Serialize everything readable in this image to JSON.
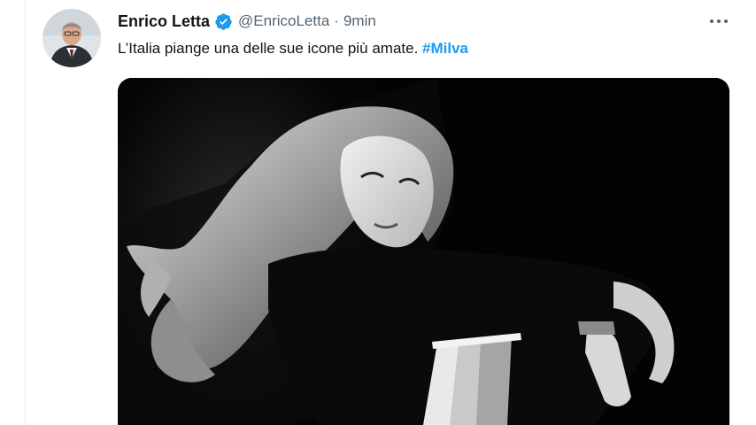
{
  "tweet": {
    "author": {
      "display_name": "Enrico Letta",
      "handle": "@EnricoLetta",
      "verified": true,
      "avatar_icon": "profile-photo"
    },
    "separator": "·",
    "timestamp": "9min",
    "text": "L’Italia piange una delle sue icone più amate. ",
    "hashtag": "#Milva",
    "more_icon": "more-horizontal-icon",
    "media": {
      "type": "photo",
      "style": "black-and-white"
    }
  },
  "colors": {
    "text_primary": "#0f1419",
    "text_secondary": "#536471",
    "accent": "#1d9bf0",
    "verified_badge": "#1d9bf0",
    "background": "#ffffff"
  }
}
